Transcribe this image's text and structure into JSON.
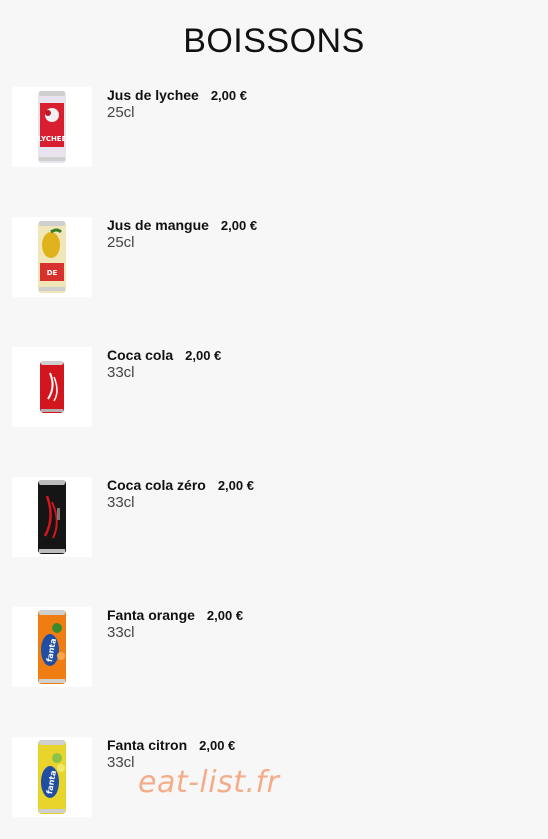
{
  "page": {
    "title": "BOISSONS",
    "watermark": "eat-list.fr"
  },
  "items": [
    {
      "name": "Jus de lychee",
      "price": "2,00 €",
      "volume": "25cl",
      "icon": "lychee-juice-can-icon",
      "colors": {
        "body": "#e9e3ee",
        "accent": "#d81e2f",
        "top": "#cfcfcf"
      }
    },
    {
      "name": "Jus de mangue",
      "price": "2,00 €",
      "volume": "25cl",
      "icon": "mango-juice-can-icon",
      "colors": {
        "body": "#f0e6b8",
        "accent": "#e0b21c",
        "top": "#cfcfcf"
      }
    },
    {
      "name": "Coca cola",
      "price": "2,00 €",
      "volume": "33cl",
      "icon": "coca-cola-can-icon",
      "colors": {
        "body": "#d3161d",
        "accent": "#ffffff",
        "top": "#cfcfcf"
      }
    },
    {
      "name": "Coca cola zéro",
      "price": "2,00 €",
      "volume": "33cl",
      "icon": "coca-cola-zero-can-icon",
      "colors": {
        "body": "#151515",
        "accent": "#d3161d",
        "top": "#bdbdbd"
      }
    },
    {
      "name": "Fanta orange",
      "price": "2,00 €",
      "volume": "33cl",
      "icon": "fanta-orange-can-icon",
      "colors": {
        "body": "#f07d12",
        "accent": "#1f4ea3",
        "top": "#cfcfcf"
      }
    },
    {
      "name": "Fanta citron",
      "price": "2,00 €",
      "volume": "33cl",
      "icon": "fanta-lemon-can-icon",
      "colors": {
        "body": "#e8d42a",
        "accent": "#1f4ea3",
        "top": "#cfcfcf"
      }
    }
  ]
}
